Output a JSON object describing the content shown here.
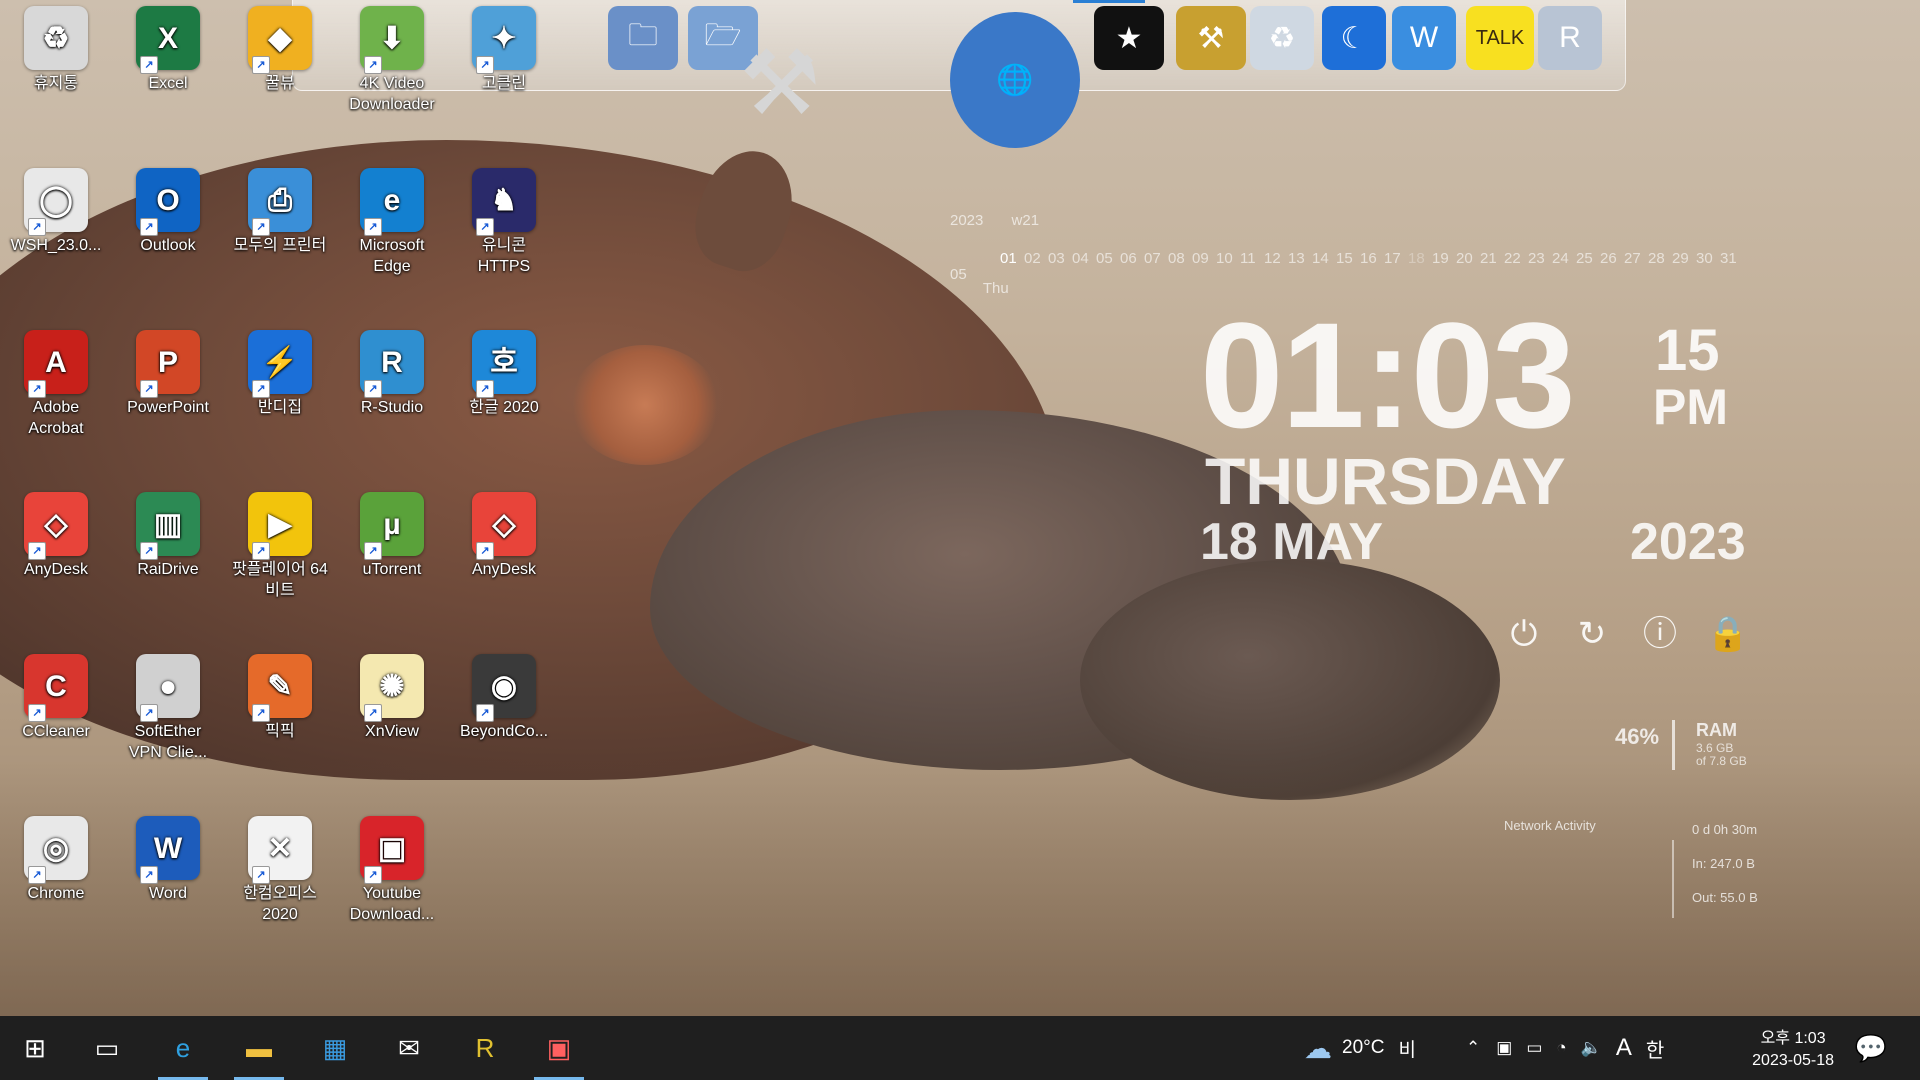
{
  "desktop_icons": [
    {
      "label": "휴지통",
      "icon": "recycle-bin-icon",
      "color": "#d8d8d8",
      "glyph": "♻"
    },
    {
      "label": "Excel",
      "icon": "excel-icon",
      "color": "#1d7a44",
      "glyph": "X"
    },
    {
      "label": "꿀뷰",
      "icon": "honeyview-icon",
      "color": "#f0b020",
      "glyph": "◆"
    },
    {
      "label": "4K Video Downloader",
      "icon": "4k-downloader-icon",
      "color": "#6fb24b",
      "glyph": "⬇"
    },
    {
      "label": "고클린",
      "icon": "goclean-icon",
      "color": "#4fa0d8",
      "glyph": "✦"
    },
    {
      "label": "WSH_23.0...",
      "icon": "file-icon",
      "color": "#e8e8e8",
      "glyph": "◯"
    },
    {
      "label": "Outlook",
      "icon": "outlook-icon",
      "color": "#0f64c4",
      "glyph": "O"
    },
    {
      "label": "모두의 프린터",
      "icon": "printer-icon",
      "color": "#3a8fd8",
      "glyph": "⎙"
    },
    {
      "label": "Microsoft Edge",
      "icon": "edge-icon",
      "color": "#1380d0",
      "glyph": "e"
    },
    {
      "label": "유니콘 HTTPS",
      "icon": "unicorn-icon",
      "color": "#2a2a6a",
      "glyph": "♞"
    },
    {
      "label": "Adobe Acrobat",
      "icon": "acrobat-icon",
      "color": "#c8201a",
      "glyph": "A"
    },
    {
      "label": "PowerPoint",
      "icon": "powerpoint-icon",
      "color": "#d24726",
      "glyph": "P"
    },
    {
      "label": "반디집",
      "icon": "bandizip-icon",
      "color": "#1b6fd8",
      "glyph": "⚡"
    },
    {
      "label": "R-Studio",
      "icon": "r-studio-icon",
      "color": "#2f8fd0",
      "glyph": "R"
    },
    {
      "label": "한글 2020",
      "icon": "hangul-icon",
      "color": "#1e88d8",
      "glyph": "호"
    },
    {
      "label": "AnyDesk",
      "icon": "anydesk-icon",
      "color": "#e8443a",
      "glyph": "◇"
    },
    {
      "label": "RaiDrive",
      "icon": "raidrive-icon",
      "color": "#2c8a54",
      "glyph": "▥"
    },
    {
      "label": "팟플레이어 64 비트",
      "icon": "potplayer-icon",
      "color": "#f2c40c",
      "glyph": "▶"
    },
    {
      "label": "uTorrent",
      "icon": "utorrent-icon",
      "color": "#5aa23a",
      "glyph": "µ"
    },
    {
      "label": "AnyDesk",
      "icon": "anydesk-icon",
      "color": "#e8443a",
      "glyph": "◇"
    },
    {
      "label": "CCleaner",
      "icon": "ccleaner-icon",
      "color": "#d8362e",
      "glyph": "C"
    },
    {
      "label": "SoftEther VPN Clie...",
      "icon": "softether-icon",
      "color": "#d0d0d0",
      "glyph": "●"
    },
    {
      "label": "픽픽",
      "icon": "picpick-icon",
      "color": "#e56a2a",
      "glyph": "✎"
    },
    {
      "label": "XnView",
      "icon": "xnview-icon",
      "color": "#f4e8b0",
      "glyph": "✺"
    },
    {
      "label": "BeyondCo...",
      "icon": "beyond-compare-icon",
      "color": "#3a3a3a",
      "glyph": "◉"
    },
    {
      "label": "Chrome",
      "icon": "chrome-icon",
      "color": "#e8e8e8",
      "glyph": "◎"
    },
    {
      "label": "Word",
      "icon": "word-icon",
      "color": "#1d5cbb",
      "glyph": "W"
    },
    {
      "label": "한컴오피스 2020",
      "icon": "hancom-office-icon",
      "color": "#f2f2f2",
      "glyph": "✕"
    },
    {
      "label": "Youtube Download...",
      "icon": "youtube-downloader-icon",
      "color": "#d8242a",
      "glyph": "▣"
    }
  ],
  "dock_items": [
    {
      "icon": "folder-blue-icon",
      "glyph": "🗀",
      "color": "#6a90c8"
    },
    {
      "icon": "folder-open-icon",
      "glyph": "🗁",
      "color": "#7aa2d4"
    },
    {
      "icon": "tools-icon",
      "glyph": "⚒",
      "color": "#9a9a9a"
    },
    {
      "icon": "internet-globe-icon",
      "glyph": "🌐",
      "color": "#3a78c8"
    },
    {
      "icon": "tshirt-icon",
      "glyph": "★",
      "color": "#111111"
    },
    {
      "icon": "hammer-icon",
      "glyph": "⚒",
      "color": "#c8a030"
    },
    {
      "icon": "trash-can-icon",
      "glyph": "♻",
      "color": "#cfd8e2"
    },
    {
      "icon": "moon-icon",
      "glyph": "☾",
      "color": "#1e6fd8"
    },
    {
      "icon": "shield-icon",
      "glyph": "W",
      "color": "#3a8ee0"
    },
    {
      "icon": "kakaotalk-icon",
      "glyph": "TALK",
      "color": "#f8e020"
    },
    {
      "icon": "registry-icon",
      "glyph": "R",
      "color": "#b8c4d4"
    }
  ],
  "clock": {
    "hours_minutes": "01:03",
    "seconds": "15",
    "ampm": "PM",
    "day": "THURSDAY",
    "date": "18 MAY",
    "year": "2023"
  },
  "calendar": {
    "year": "2023",
    "week": "w21",
    "month": "05",
    "weekday": "Thu",
    "days": [
      "01",
      "02",
      "03",
      "04",
      "05",
      "06",
      "07",
      "08",
      "09",
      "10",
      "11",
      "12",
      "13",
      "14",
      "15",
      "16",
      "17",
      "18",
      "19",
      "20",
      "21",
      "22",
      "23",
      "24",
      "25",
      "26",
      "27",
      "28",
      "29",
      "30",
      "31"
    ]
  },
  "system_monitor": {
    "ram_percent": "46%",
    "ram_label": "RAM",
    "ram_used": "3.6 GB",
    "ram_total": "of 7.8 GB",
    "network_title": "Network Activity",
    "uptime": "0 d 0h 30m",
    "net_in": "In: 247.0 B",
    "net_out": "Out: 55.0 B"
  },
  "taskbar": {
    "weather_temp": "20°C",
    "weather_desc": "비",
    "input_lang": "A",
    "ime": "한",
    "time": "오후 1:03",
    "date": "2023-05-18"
  }
}
